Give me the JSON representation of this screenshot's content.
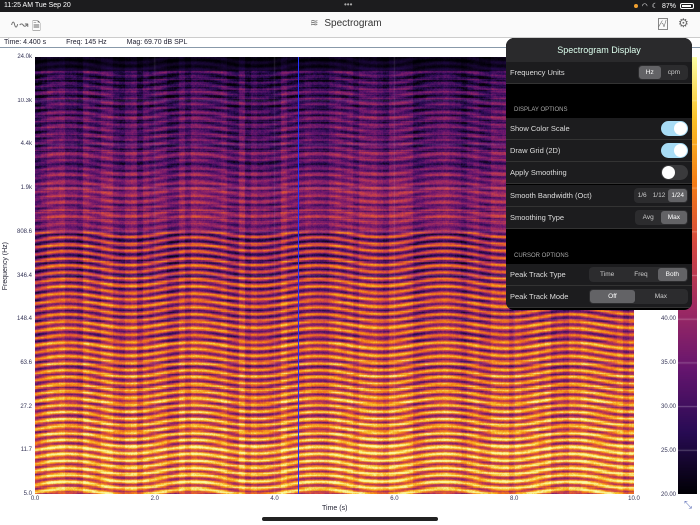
{
  "status": {
    "time": "11:25 AM  Tue Sep 20",
    "battery": "87%"
  },
  "toolbar": {
    "title": "Spectrogram"
  },
  "readout": {
    "time": "Time: 4.400 s",
    "freq": "Freq: 145 Hz",
    "mag": "Mag: 69.70 dB SPL"
  },
  "chart_data": {
    "type": "heatmap",
    "xlabel": "Time (s)",
    "ylabel": "Frequency (Hz)",
    "x_ticks": [
      "0.0",
      "2.0",
      "4.0",
      "6.0",
      "8.0",
      "10.0"
    ],
    "y_ticks": [
      "24.0k",
      "10.3k",
      "4.4k",
      "1.9k",
      "808.6",
      "346.4",
      "148.4",
      "63.6",
      "27.2",
      "11.7",
      "5.0"
    ],
    "xlim": [
      0,
      10
    ],
    "cursor_time": 4.4,
    "color_scale_ticks": [
      "40.00",
      "35.00",
      "30.00",
      "25.00",
      "20.00"
    ]
  },
  "popover": {
    "title": "Spectrogram Display",
    "freq_units_label": "Frequency Units",
    "freq_units": [
      "Hz",
      "cpm"
    ],
    "display_options": "DISPLAY OPTIONS",
    "show_color_scale": "Show Color Scale",
    "draw_grid": "Draw Grid (2D)",
    "apply_smoothing": "Apply Smoothing",
    "smooth_bw": "Smooth Bandwidth (Oct)",
    "smooth_bw_opts": [
      "1/6",
      "1/12",
      "1/24"
    ],
    "smooth_type": "Smoothing Type",
    "smooth_type_opts": [
      "Avg",
      "Max"
    ],
    "cursor_options": "CURSOR OPTIONS",
    "peak_type": "Peak Track Type",
    "peak_type_opts": [
      "Time",
      "Freq",
      "Both"
    ],
    "peak_mode": "Peak Track Mode",
    "peak_mode_opts": [
      "Off",
      "Max"
    ]
  }
}
